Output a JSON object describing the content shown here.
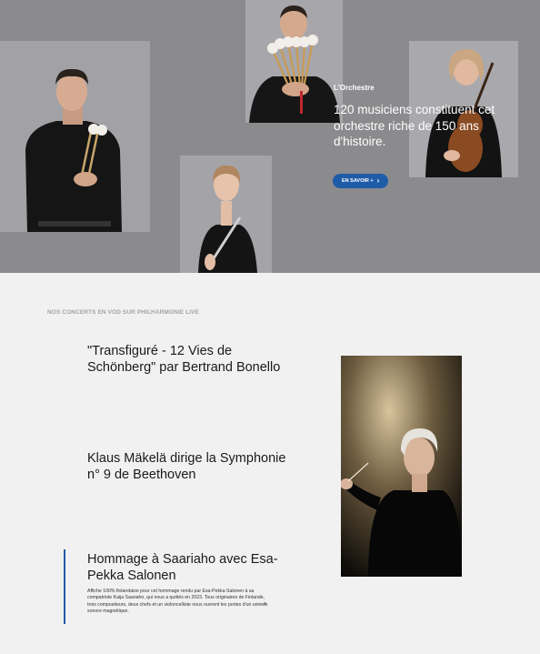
{
  "hero": {
    "kicker": "L'Orchestre",
    "title": "120 musiciens constituent cet orchestre riche de 150 ans d'histoire.",
    "button_label": "EN SAVOIR +",
    "button_icon": "chevron-right-icon",
    "background_color": "#8b8b8e",
    "accent_color": "#1f5ca8"
  },
  "vod": {
    "section_label": "NOS CONCERTS EN VOD SUR PHILHARMONIE LIVE",
    "concerts": [
      {
        "title": "\"Transfiguré - 12 Vies de Schönberg\" par Bertrand Bonello"
      },
      {
        "title": "Klaus Mäkelä dirige la Symphonie n° 9 de Beethoven"
      },
      {
        "title": "Hommage à Saariaho avec Esa-Pekka Salonen",
        "description": "Affiche 100% finlandaise pour cet hommage rendu par Esa-Pekka Salonen à sa compatriote Kaija Saariaho, qui nous a quittés en 2023. Tous originaires de Finlande, trois compositeurs, deux chefs et un violoncelliste nous ouvrent les portes d'un univers sonore magnétique.",
        "icon": "chevron-right-icon"
      }
    ]
  }
}
